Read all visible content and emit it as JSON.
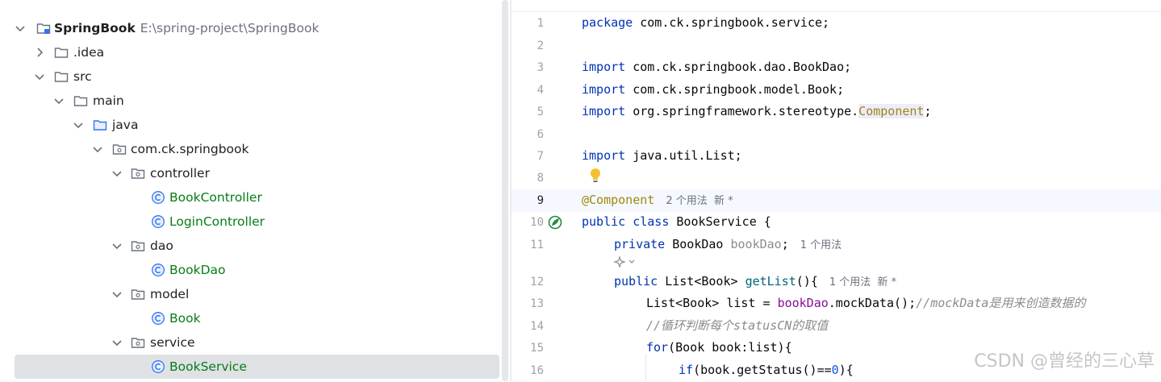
{
  "project_tree": {
    "project_name": "SpringBook",
    "project_path": "E:\\spring-project\\SpringBook",
    "items": [
      {
        "label": ".idea"
      },
      {
        "label": "src"
      },
      {
        "label": "main"
      },
      {
        "label": "java"
      },
      {
        "label": "com.ck.springbook"
      },
      {
        "label": "controller"
      },
      {
        "label": "BookController"
      },
      {
        "label": "LoginController"
      },
      {
        "label": "dao"
      },
      {
        "label": "BookDao"
      },
      {
        "label": "model"
      },
      {
        "label": "Book"
      },
      {
        "label": "service"
      },
      {
        "label": "BookService"
      }
    ],
    "selected": "BookService"
  },
  "editor": {
    "line_numbers": [
      "1",
      "2",
      "3",
      "4",
      "5",
      "6",
      "7",
      "8",
      "9",
      "10",
      "11",
      "12",
      "13",
      "14",
      "15",
      "16"
    ],
    "tokens": {
      "package_kw": "package",
      "package_name": " com.ck.springbook.service;",
      "import_kw": "import",
      "import1": " com.ck.springbook.dao.BookDao;",
      "import2": " com.ck.springbook.model.Book;",
      "import3_pre": " org.springframework.stereotype.",
      "import3_hl": "Component",
      "import3_post": ";",
      "import4": " java.util.List;",
      "annotation": "@Component",
      "hint_usages2_new": "2 个用法  新 *",
      "public_kw": "public",
      "class_kw": " class",
      "class_rest": " BookService {",
      "private_kw": "private",
      "field_type": " BookDao ",
      "field_name": "bookDao",
      "field_semi": ";",
      "hint_usages1": "1 个用法",
      "method_kw": "public",
      "method_type": " List<Book> ",
      "method_name": "getList",
      "method_rest": "(){",
      "hint_usages1_new": "1 个用法  新 *",
      "l13_a": "List<Book> list = ",
      "l13_field": "bookDao",
      "l13_b": ".mockData();",
      "l13_cmt": "//mockData是用来创造数据的",
      "l14_cmt": "//循环判断每个statusCN的取值",
      "for_kw": "for",
      "for_rest": "(Book book:list){",
      "if_kw": "if",
      "if_a": "(book.getStatus()==",
      "if_num": "0",
      "if_b": "){"
    }
  },
  "watermark": "CSDN @曾经的三心草",
  "colors": {
    "selection": "#dfe1e5",
    "keyword": "#0033b3",
    "annotation": "#9e880d",
    "field": "#871094",
    "class_name_green": "#067d17",
    "comment": "#8c8c8c"
  },
  "icons": [
    "chevron-right-icon",
    "chevron-down-icon",
    "module-folder-icon",
    "folder-icon",
    "package-icon",
    "class-icon",
    "bulb-icon",
    "bean-gutter-icon",
    "ai-assist-icon"
  ]
}
